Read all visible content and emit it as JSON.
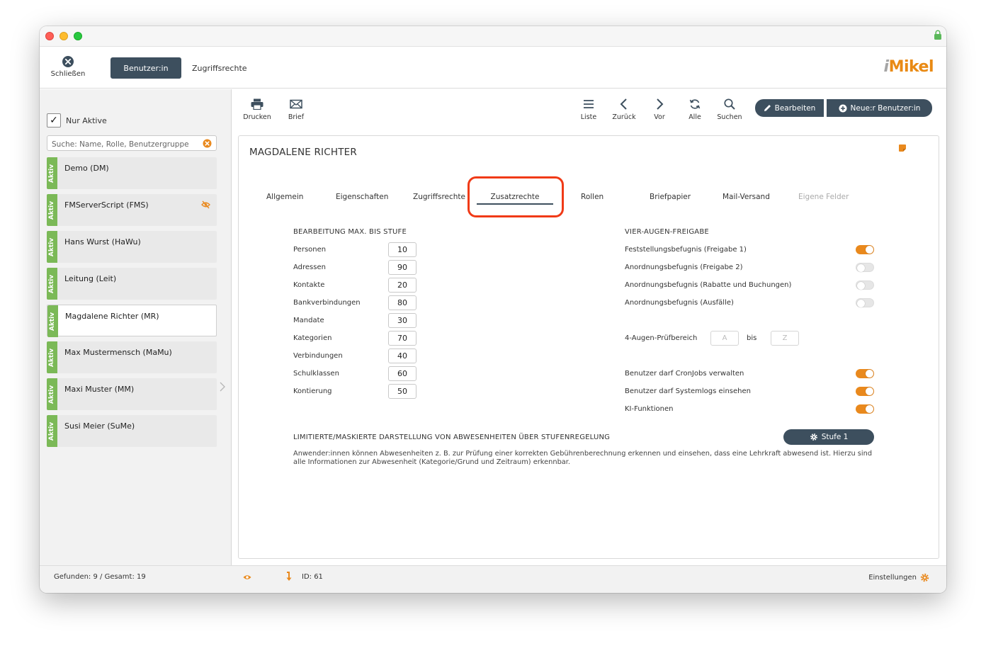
{
  "topbar": {
    "close_label": "Schließen",
    "tab_user": "Benutzer:in",
    "tab_access": "Zugriffsrechte",
    "logo_i": "i",
    "logo_rest": "Mikel"
  },
  "sidebar": {
    "filter_label": "Nur Aktive",
    "search_placeholder": "Suche: Name, Rolle, Benutzergruppe",
    "badge_text": "Aktiv",
    "users": [
      {
        "name": "Demo (DM)"
      },
      {
        "name": "FMServerScript (FMS)"
      },
      {
        "name": "Hans Wurst (HaWu)"
      },
      {
        "name": "Leitung (Leit)"
      },
      {
        "name": "Magdalene Richter (MR)"
      },
      {
        "name": "Max Mustermensch (MaMu)"
      },
      {
        "name": "Maxi Muster (MM)"
      },
      {
        "name": "Susi Meier (SuMe)"
      }
    ]
  },
  "toolbar": {
    "print": "Drucken",
    "letter": "Brief",
    "list": "Liste",
    "back": "Zurück",
    "forward": "Vor",
    "all": "Alle",
    "search": "Suchen",
    "edit": "Bearbeiten",
    "new_user": "Neue:r Benutzer:in"
  },
  "panel": {
    "title": "MAGDALENE RICHTER",
    "tabs": [
      "Allgemein",
      "Eigenschaften",
      "Zugriffsrechte",
      "Zusatzrechte",
      "Rollen",
      "Briefpapier",
      "Mail-Versand",
      "Eigene Felder"
    ],
    "left_section": {
      "heading": "BEARBEITUNG MAX. BIS STUFE",
      "rows": [
        {
          "label": "Personen",
          "value": "10"
        },
        {
          "label": "Adressen",
          "value": "90"
        },
        {
          "label": "Kontakte",
          "value": "20"
        },
        {
          "label": "Bankverbindungen",
          "value": "80"
        },
        {
          "label": "Mandate",
          "value": "30"
        },
        {
          "label": "Kategorien",
          "value": "70"
        },
        {
          "label": "Verbindungen",
          "value": "40"
        },
        {
          "label": "Schulklassen",
          "value": "60"
        },
        {
          "label": "Kontierung",
          "value": "50"
        }
      ]
    },
    "right_section": {
      "heading": "VIER-AUGEN-FREIGABE",
      "toggles": [
        {
          "label": "Feststellungsbefugnis (Freigabe 1)",
          "on": true
        },
        {
          "label": "Anordnungsbefugnis (Freigabe 2)",
          "on": false
        },
        {
          "label": "Anordnungsbefugnis (Rabatte und Buchungen)",
          "on": false
        },
        {
          "label": "Anordnungsbefugnis (Ausfälle)",
          "on": false
        }
      ],
      "range": {
        "label": "4-Augen-Prüfbereich",
        "from_placeholder": "A",
        "between": "bis",
        "to_placeholder": "Z"
      },
      "extra_toggles": [
        {
          "label": "Benutzer darf CronJobs verwalten",
          "on": true
        },
        {
          "label": "Benutzer darf Systemlogs einsehen",
          "on": true
        },
        {
          "label": "KI-Funktionen",
          "on": true
        }
      ]
    },
    "limit_section": {
      "heading": "LIMITIERTE/MASKIERTE DARSTELLUNG VON ABWESENHEITEN ÜBER STUFENREGELUNG",
      "button": "Stufe 1",
      "description": "Anwender:innen können Abwesenheiten z. B. zur Prüfung einer korrekten Gebührenberechnung erkennen und einsehen, dass eine Lehrkraft abwesend ist. Hierzu sind alle Informationen zur Abwesenheit (Kategorie/Grund und Zeitraum) erkennbar."
    }
  },
  "statusbar": {
    "found": "Gefunden: 9 / Gesamt: 19",
    "id": "ID: 61",
    "settings": "Einstellungen"
  },
  "colors": {
    "accent": "#e9891d",
    "dark": "#3d4f5e",
    "active_badge": "#7bb957",
    "highlight": "#f03a17"
  }
}
